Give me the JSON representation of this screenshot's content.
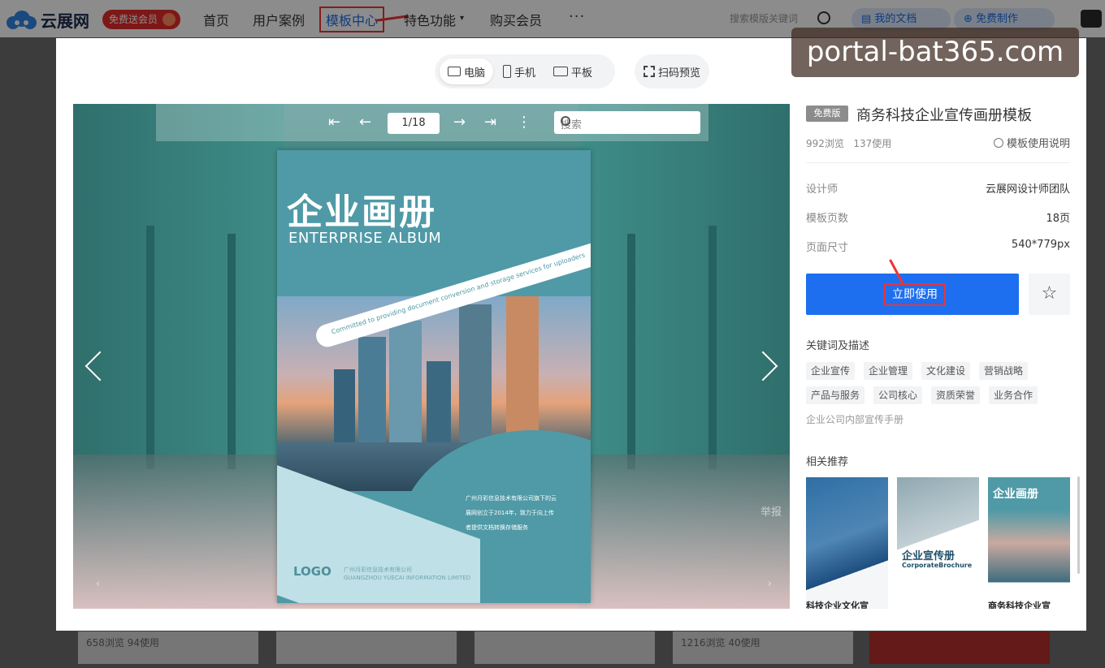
{
  "topbar": {
    "logo_text": "云展网",
    "vip_label": "免费送会员",
    "nav": [
      "首页",
      "用户案例",
      "模板中心",
      "特色功能",
      "购买会员"
    ],
    "more": "···",
    "search_placeholder": "搜索模版关键词",
    "my_docs": "我的文档",
    "free_create": "免费制作"
  },
  "background_cards": [
    {
      "stats": "658浏览  94使用"
    },
    {
      "stats": "1216浏览  40使用"
    }
  ],
  "modal": {
    "device_tabs": [
      "电脑",
      "手机",
      "平板"
    ],
    "active_device": "电脑",
    "scan_preview": "扫码预览",
    "viewer": {
      "page_indicator": "1/18",
      "search_placeholder": "搜索",
      "corner_label": "举报"
    },
    "book": {
      "title": "企业画册",
      "subtitle": "ENTERPRISE ALBUM",
      "band_text": "Committed to providing document conversion and storage services for uploaders",
      "para": [
        "广州月彩信息技术有限公司旗下的云",
        "展网创立于2014年，致力于向上传",
        "者提供文档转换存储服务"
      ],
      "logo": "LOGO",
      "company_cn": "广州月彩信息技术有限公司",
      "company_en": "GUANGZHOU YUECAI INFORMATION LIMITED"
    },
    "info": {
      "tag": "免费版",
      "title": "商务科技企业宣传画册模板",
      "views": "992浏览",
      "uses": "137使用",
      "guide": "模板使用说明",
      "rows": [
        {
          "label": "设计师",
          "value": "云展网设计师团队"
        },
        {
          "label": "模板页数",
          "value": "18页"
        },
        {
          "label": "页面尺寸",
          "value": "540*779px"
        }
      ],
      "use_button": "立即使用",
      "keywords_heading": "关键词及描述",
      "keywords": [
        "企业宣传",
        "企业管理",
        "文化建设",
        "营销战略",
        "产品与服务",
        "公司核心",
        "资质荣誉",
        "业务合作"
      ],
      "description": "企业公司内部宣传手册",
      "related_heading": "相关推荐",
      "related": [
        {
          "label": "科技企业文化宣"
        },
        {
          "label": "企业宣传册",
          "sub": "CorporateBrochure"
        },
        {
          "label": "商务科技企业宣",
          "inner": "企业画册"
        }
      ]
    }
  },
  "watermark": "portal-bat365.com",
  "colors": {
    "accent": "#1d6ff0",
    "highlight": "#e33333",
    "teal": "#4f9aa6"
  }
}
